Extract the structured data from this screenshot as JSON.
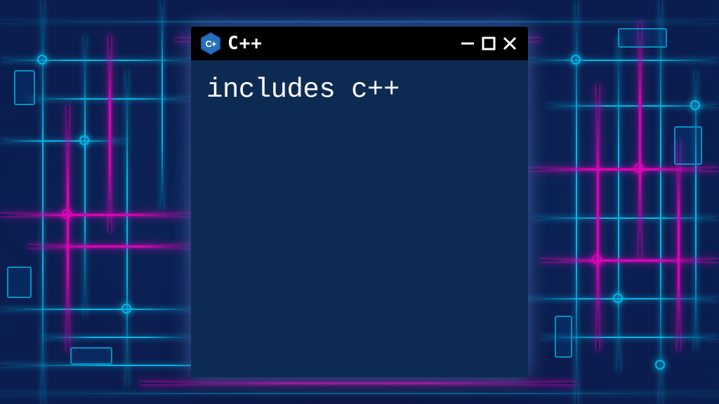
{
  "window": {
    "title": "C++",
    "icon_label": "C++",
    "icon_name": "cpp-hexagon-icon"
  },
  "terminal": {
    "content": "includes c++"
  },
  "colors": {
    "titlebar_bg": "#000000",
    "terminal_bg": "#0d2b52",
    "text": "#ffffff",
    "accent_cyan": "#00d4ff",
    "accent_magenta": "#ff00c8",
    "icon_bg": "#2670bb"
  }
}
